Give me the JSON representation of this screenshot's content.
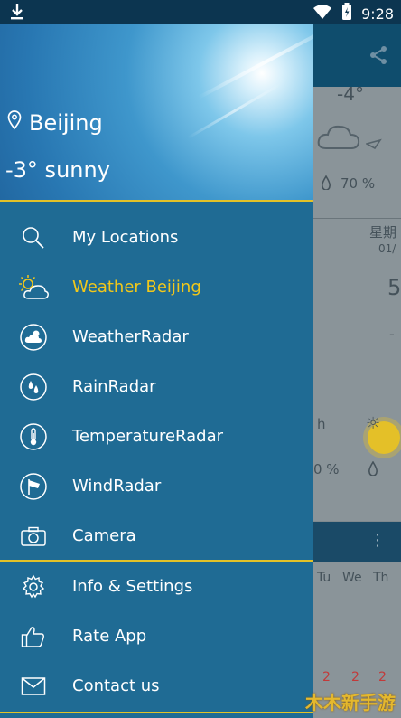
{
  "status_bar": {
    "time": "9:28",
    "icons": [
      "download-icon",
      "wifi-icon",
      "battery-charging-icon"
    ]
  },
  "drawer": {
    "location": "Beijing",
    "current_weather": "-3° sunny",
    "accent_color": "#e3c228",
    "menu": [
      {
        "label": "My Locations",
        "icon": "search-icon",
        "active": false
      },
      {
        "label": "Weather Beijing",
        "icon": "sun-cloud-icon",
        "active": true
      },
      {
        "label": "WeatherRadar",
        "icon": "weather-radar-icon",
        "active": false
      },
      {
        "label": "RainRadar",
        "icon": "rain-radar-icon",
        "active": false
      },
      {
        "label": "TemperatureRadar",
        "icon": "thermometer-icon",
        "active": false
      },
      {
        "label": "WindRadar",
        "icon": "wind-radar-icon",
        "active": false
      },
      {
        "label": "Camera",
        "icon": "camera-icon",
        "active": false
      }
    ],
    "secondary_menu": [
      {
        "label": "Info & Settings",
        "icon": "gear-icon"
      },
      {
        "label": "Rate App",
        "icon": "thumbs-up-icon"
      },
      {
        "label": "Contact us",
        "icon": "envelope-icon"
      }
    ]
  },
  "background": {
    "temp": "-4°",
    "humidity": "70 %",
    "day_label": "星期",
    "date": "01/",
    "big_num": "5",
    "small_neg": "-",
    "hour": "h",
    "percent": "0 %",
    "weekdays": [
      "Tu",
      "We",
      "Th"
    ],
    "red_nums": [
      "2",
      "2",
      "2"
    ]
  },
  "watermark": "木木新手游"
}
